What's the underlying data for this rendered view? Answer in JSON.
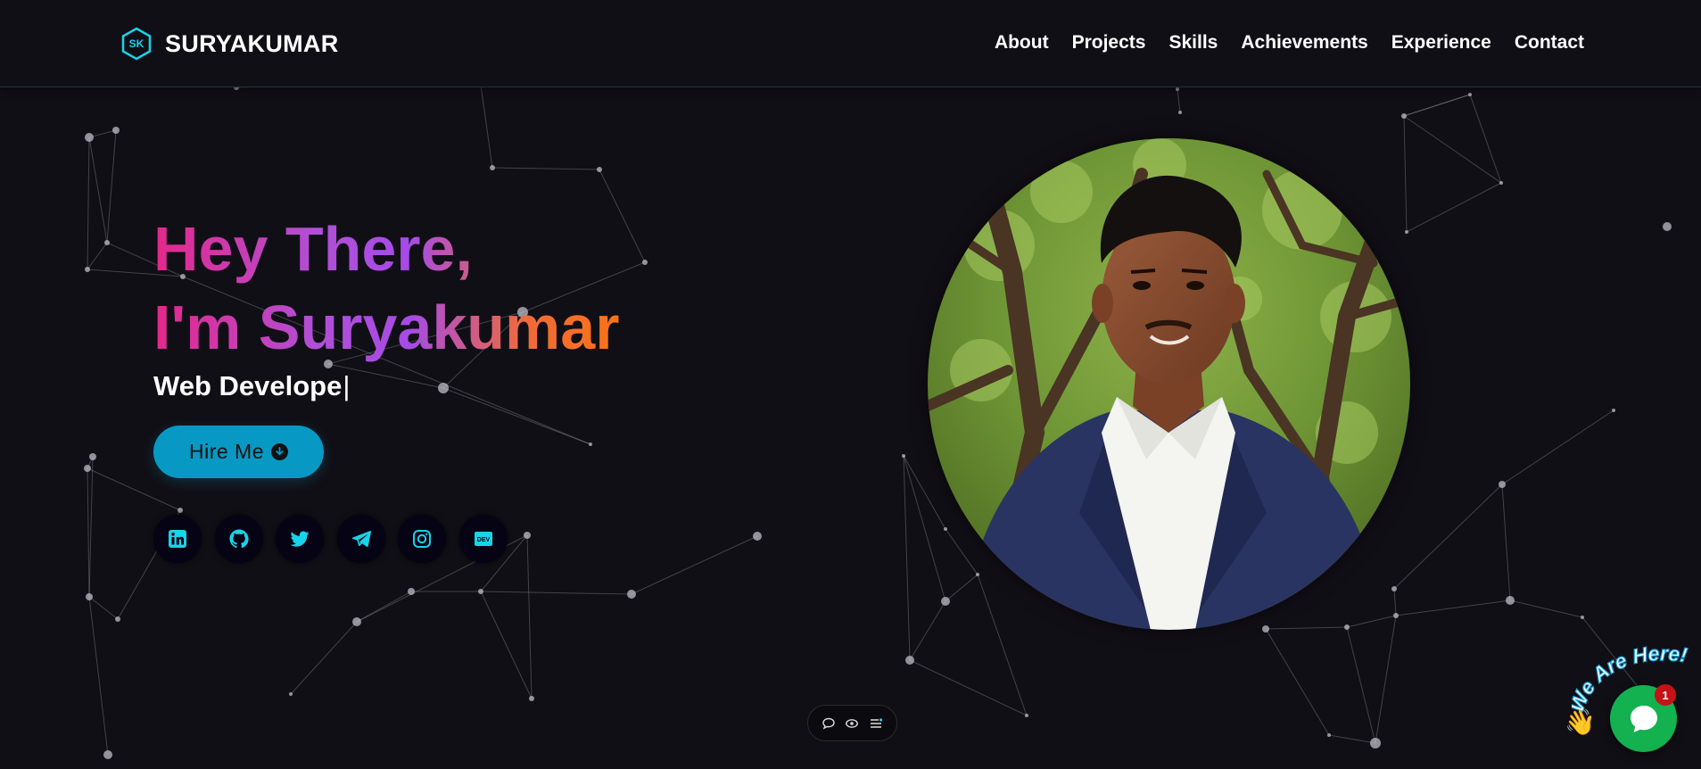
{
  "brand": {
    "logo_text": "SK",
    "name": "SURYAKUMAR"
  },
  "nav": {
    "items": [
      "About",
      "Projects",
      "Skills",
      "Achievements",
      "Experience",
      "Contact"
    ]
  },
  "hero": {
    "greeting": "Hey There,",
    "intro": "I'm Suryakumar",
    "role": "Web Develope",
    "cursor": "|",
    "hire_label": "Hire Me"
  },
  "socials": [
    "linkedin-icon",
    "github-icon",
    "twitter-icon",
    "telegram-icon",
    "instagram-icon",
    "dev-icon"
  ],
  "dev_icon_text": "DEV",
  "bottom_bar": {
    "icons": [
      "comment-icon",
      "eye-icon",
      "list-icon"
    ]
  },
  "chat": {
    "banner": "We Are Here!",
    "wave": "👋",
    "badge": "1"
  },
  "colors": {
    "background": "#110f16",
    "accent": "#0898c4",
    "social_icon": "#19d3e8",
    "chat_green": "#13b150",
    "badge_red": "#c41217",
    "gradient_pink": "#e4288b",
    "gradient_purple": "#a64be6",
    "gradient_orange": "#f97316"
  }
}
